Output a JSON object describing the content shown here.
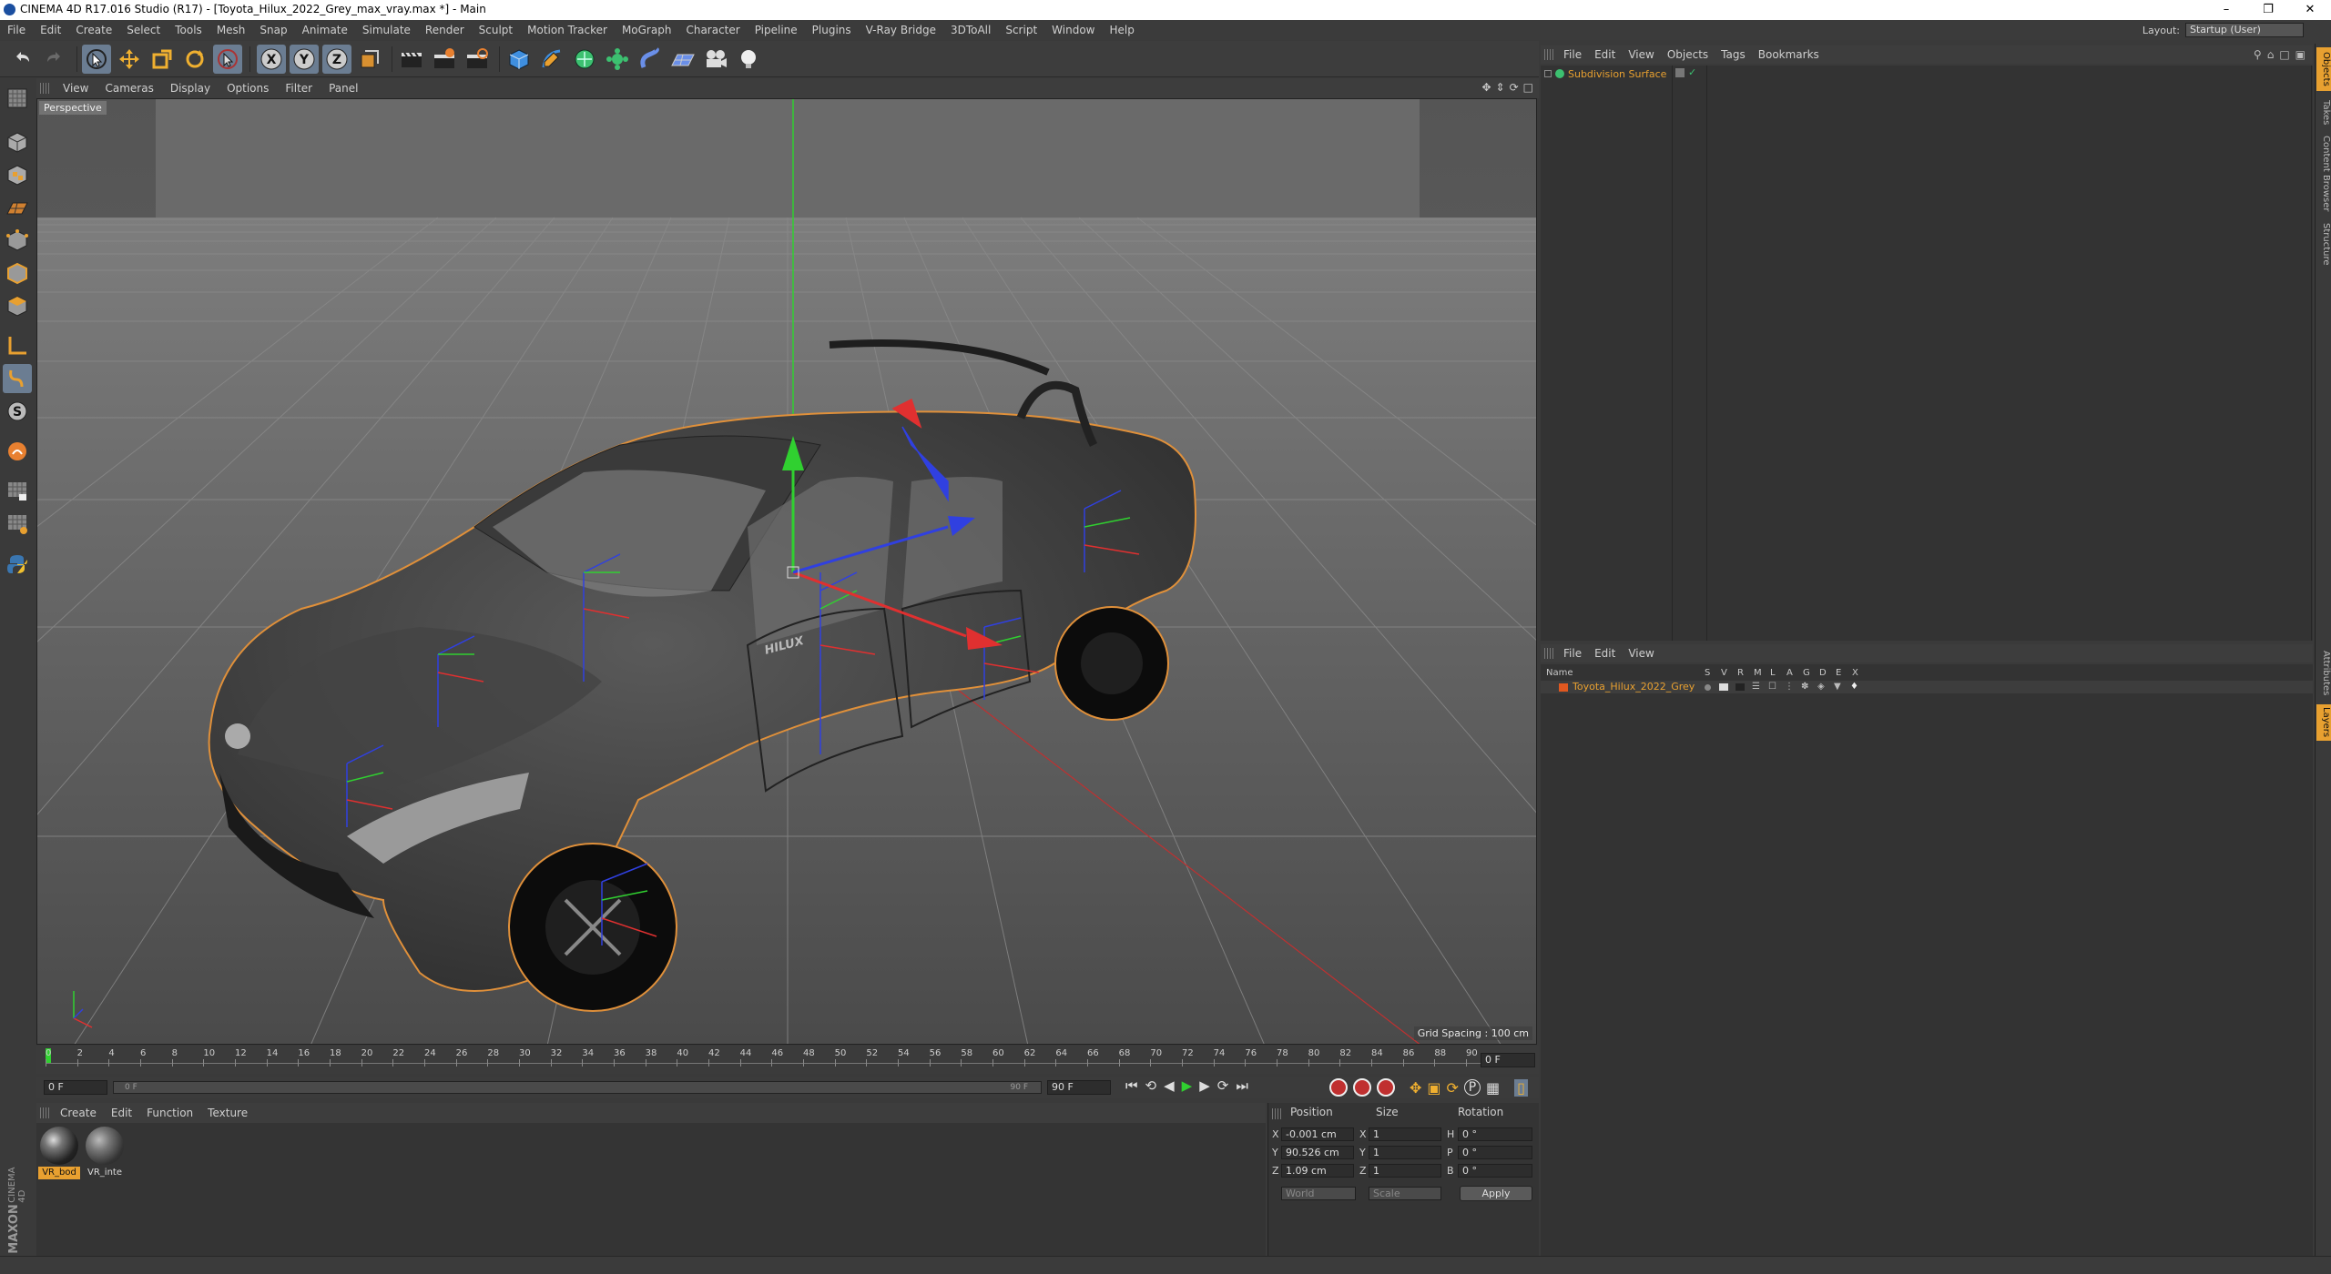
{
  "window": {
    "title": "CINEMA 4D R17.016 Studio (R17) - [Toyota_Hilux_2022_Grey_max_vray.max *] - Main"
  },
  "menu": [
    "File",
    "Edit",
    "Create",
    "Select",
    "Tools",
    "Mesh",
    "Snap",
    "Animate",
    "Simulate",
    "Render",
    "Sculpt",
    "Motion Tracker",
    "MoGraph",
    "Character",
    "Pipeline",
    "Plugins",
    "V-Ray Bridge",
    "3DToAll",
    "Script",
    "Window",
    "Help"
  ],
  "layout": {
    "label": "Layout:",
    "value": "Startup (User)"
  },
  "viewport": {
    "menu": [
      "View",
      "Cameras",
      "Display",
      "Options",
      "Filter",
      "Panel"
    ],
    "camera_label": "Perspective",
    "grid_spacing": "Grid Spacing : 100 cm",
    "model_badge": "HILUX"
  },
  "timeline": {
    "ticks": [
      "0",
      "2",
      "4",
      "6",
      "8",
      "10",
      "12",
      "14",
      "16",
      "18",
      "20",
      "22",
      "24",
      "26",
      "28",
      "30",
      "32",
      "34",
      "36",
      "38",
      "40",
      "42",
      "44",
      "46",
      "48",
      "50",
      "52",
      "54",
      "56",
      "58",
      "60",
      "62",
      "64",
      "66",
      "68",
      "70",
      "72",
      "74",
      "76",
      "78",
      "80",
      "82",
      "84",
      "86",
      "88",
      "90"
    ],
    "current_frame": "0 F",
    "start_field": "0 F",
    "slider_start": "0 F",
    "slider_end": "90 F",
    "end_field": "90 F"
  },
  "materials": {
    "menu": [
      "Create",
      "Edit",
      "Function",
      "Texture"
    ],
    "items": [
      {
        "label": "VR_bod",
        "selected": true
      },
      {
        "label": "VR_inte",
        "selected": false
      }
    ]
  },
  "coordinates": {
    "headers": {
      "position": "Position",
      "size": "Size",
      "rotation": "Rotation"
    },
    "position": {
      "x": "-0.001 cm",
      "y": "90.526 cm",
      "z": "1.09 cm"
    },
    "size": {
      "x": "1",
      "y": "1",
      "z": "1"
    },
    "rotation": {
      "h": "0 °",
      "p": "0 °",
      "b": "0 °"
    },
    "axis_labels": {
      "x": "X",
      "y": "Y",
      "z": "Z",
      "h": "H",
      "p": "P",
      "b": "B"
    },
    "mode_world": "World",
    "mode_scale": "Scale",
    "apply": "Apply"
  },
  "objects": {
    "menu": [
      "File",
      "Edit",
      "View",
      "Objects",
      "Tags",
      "Bookmarks"
    ],
    "item": "Subdivision Surface"
  },
  "layers": {
    "menu": [
      "File",
      "Edit",
      "View"
    ],
    "name_header": "Name",
    "columns": [
      "S",
      "V",
      "R",
      "M",
      "L",
      "A",
      "G",
      "D",
      "E",
      "X"
    ],
    "item": "Toyota_Hilux_2022_Grey"
  },
  "sidetabs": [
    "Objects",
    "Takes",
    "Content Browser",
    "Structure",
    "Attributes",
    "Layers"
  ],
  "brand": {
    "line1": "MAXON",
    "line2": "CINEMA 4D"
  },
  "colors": {
    "accent": "#e8a030",
    "highlight": "#6b7d92",
    "axis_x": "#e03030",
    "axis_y": "#30d030",
    "axis_z": "#3040e0"
  }
}
